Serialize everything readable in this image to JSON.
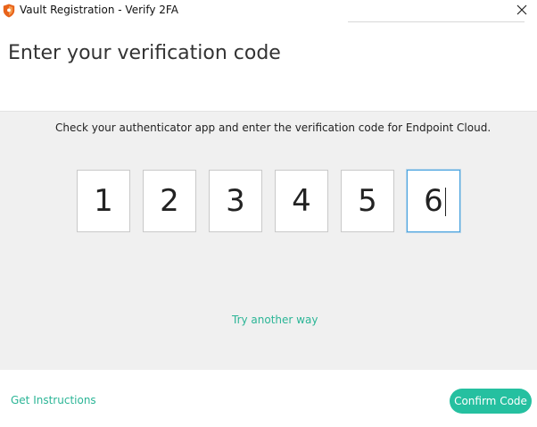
{
  "window": {
    "title": "Vault Registration - Verify 2FA",
    "icon": "shield-icon",
    "close_icon": "close-icon"
  },
  "header": {
    "title": "Enter your verification code"
  },
  "panel": {
    "instruction": "Check your authenticator app and enter the verification code for Endpoint Cloud.",
    "code_digits": [
      "1",
      "2",
      "3",
      "4",
      "5",
      "6"
    ],
    "active_digit_index": 5,
    "try_another_way": "Try another way"
  },
  "footer": {
    "instructions_link": "Get Instructions",
    "confirm_button": "Confirm Code"
  },
  "colors": {
    "accent": "#25c0a0",
    "link": "#2bb596",
    "focus_border": "#4aa3df",
    "panel_bg": "#f0f0f0",
    "shield": "#e8631a"
  }
}
